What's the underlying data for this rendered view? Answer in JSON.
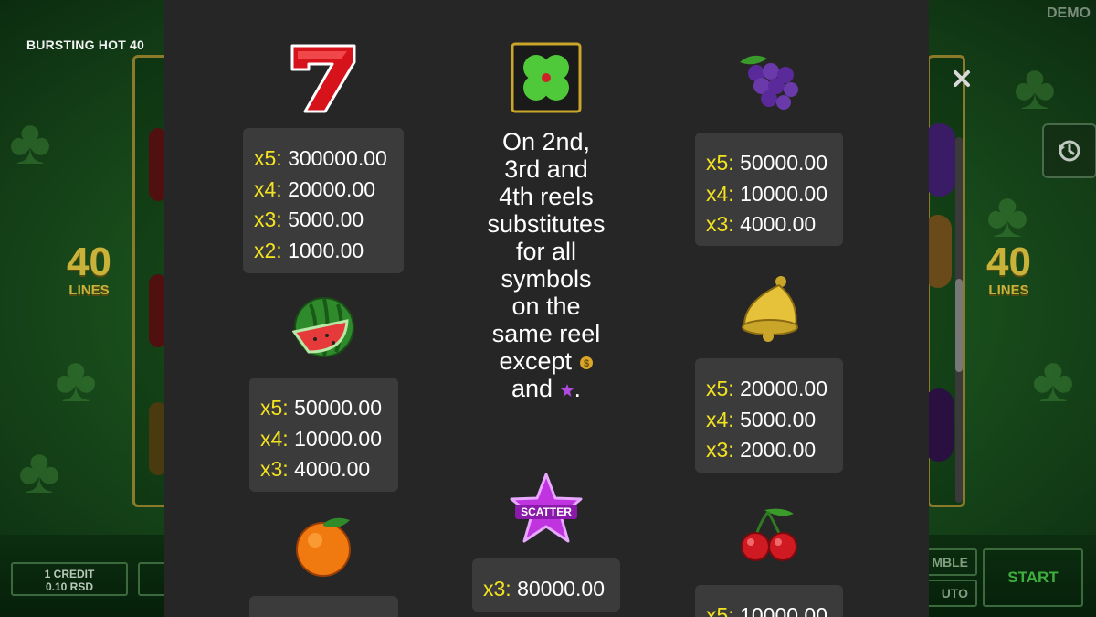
{
  "game": {
    "title": "BURSTING HOT 40",
    "mode_label": "DEMO"
  },
  "background": {
    "lines_left": {
      "number": "40",
      "label": "LINES"
    },
    "lines_right": {
      "number": "40",
      "label": "LINES"
    },
    "credit": {
      "line1": "1 CREDIT",
      "line2": "0.10 RSD"
    },
    "gamble_label": "MBLE",
    "auto_label": "UTO",
    "start_label": "START",
    "history_icon": "history-icon"
  },
  "paytable": {
    "columns": [
      {
        "items": [
          {
            "symbol": "seven",
            "icon": "seven-icon",
            "pays": [
              {
                "mult": "x5:",
                "amount": "300000.00"
              },
              {
                "mult": "x4:",
                "amount": "20000.00"
              },
              {
                "mult": "x3:",
                "amount": "5000.00"
              },
              {
                "mult": "x2:",
                "amount": "1000.00"
              }
            ]
          },
          {
            "symbol": "watermelon",
            "icon": "watermelon-icon",
            "pays": [
              {
                "mult": "x5:",
                "amount": "50000.00"
              },
              {
                "mult": "x4:",
                "amount": "10000.00"
              },
              {
                "mult": "x3:",
                "amount": "4000.00"
              }
            ]
          },
          {
            "symbol": "orange",
            "icon": "orange-icon",
            "pays": []
          }
        ]
      },
      {
        "items": [
          {
            "symbol": "clover",
            "icon": "clover-wild-icon",
            "description": [
              "On 2nd,",
              "3rd and",
              "4th reels",
              "substitutes",
              "for all",
              "symbols",
              "on the",
              "same reel"
            ],
            "description_except": "except",
            "description_and": "and",
            "description_end": "."
          },
          {
            "symbol": "scatter",
            "icon": "scatter-star-icon",
            "label": "SCATTER",
            "pays": [
              {
                "mult": "x3:",
                "amount": "80000.00"
              }
            ]
          }
        ]
      },
      {
        "items": [
          {
            "symbol": "grapes",
            "icon": "grapes-icon",
            "pays": [
              {
                "mult": "x5:",
                "amount": "50000.00"
              },
              {
                "mult": "x4:",
                "amount": "10000.00"
              },
              {
                "mult": "x3:",
                "amount": "4000.00"
              }
            ]
          },
          {
            "symbol": "bell",
            "icon": "bell-icon",
            "pays": [
              {
                "mult": "x5:",
                "amount": "20000.00"
              },
              {
                "mult": "x4:",
                "amount": "5000.00"
              },
              {
                "mult": "x3:",
                "amount": "2000.00"
              }
            ]
          },
          {
            "symbol": "cherry",
            "icon": "cherry-icon",
            "pays": [
              {
                "mult": "x5:",
                "amount": "10000.00"
              }
            ]
          }
        ]
      }
    ]
  },
  "colors": {
    "overlay_bg": "#262626",
    "box_bg": "#3b3b3b",
    "multiplier": "#f3e21f",
    "text": "#ffffff"
  }
}
